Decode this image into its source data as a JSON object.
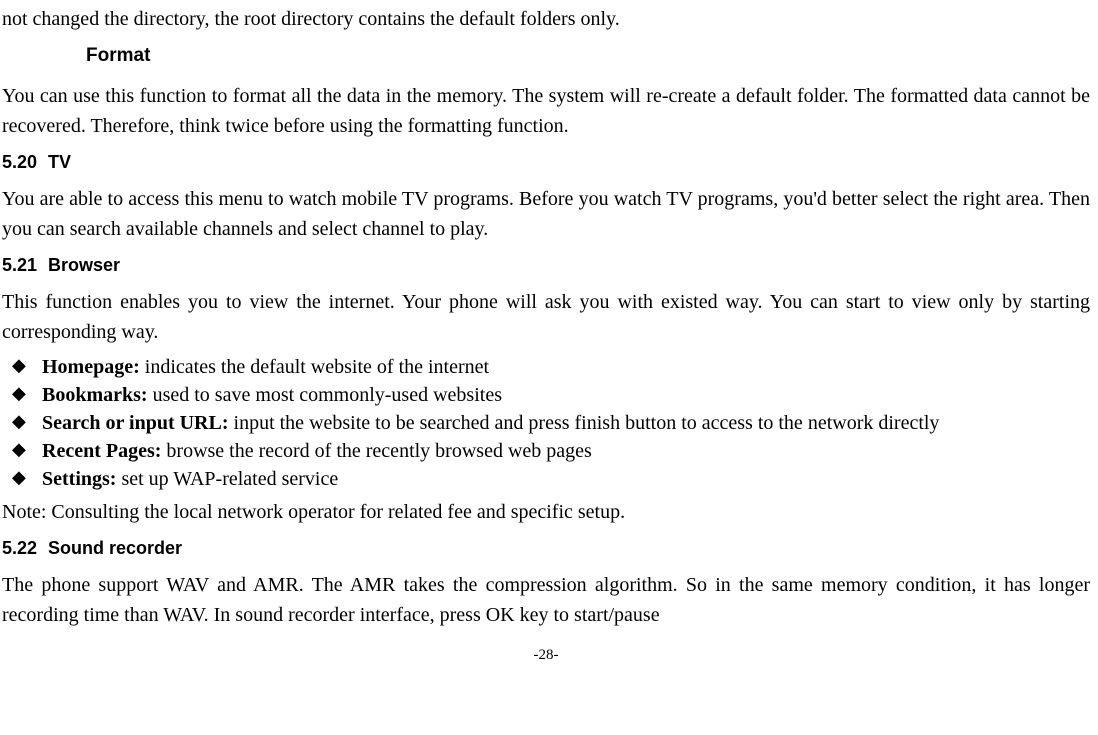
{
  "intro_fragment": "not changed the directory, the root directory contains the default folders only.",
  "format": {
    "heading": "Format",
    "body": "You can use this function to format all the data in the memory. The system will re-create a default folder. The formatted data cannot be recovered. Therefore, think twice before using the formatting function."
  },
  "tv": {
    "number": "5.20",
    "title": "TV",
    "body": "You are able to access this menu to watch mobile TV programs. Before you watch TV programs, you'd better select the right area. Then you can search available channels and select channel to play."
  },
  "browser": {
    "number": "5.21",
    "title": "Browser",
    "intro": "This function enables you to view the internet. Your phone will ask you with existed way. You can start to view only by starting corresponding way.",
    "items": [
      {
        "label": "Homepage:",
        "text": " indicates the default website of the internet"
      },
      {
        "label": "Bookmarks:",
        "text": " used to save most commonly-used websites"
      },
      {
        "label": "Search or input URL:",
        "text": " input the website to be searched and press finish button to access to the network directly"
      },
      {
        "label": "Recent Pages:",
        "text": " browse the record of the recently browsed web pages"
      },
      {
        "label": "Settings:",
        "text": " set up WAP-related service"
      }
    ],
    "note": "Note:    Consulting the local network operator for related fee and specific setup."
  },
  "sound_recorder": {
    "number": "5.22",
    "title": "Sound recorder",
    "body": "The phone support WAV and AMR. The AMR takes the compression algorithm. So in the same memory condition, it has longer recording time than WAV.   In sound recorder interface, press OK key to start/pause"
  },
  "page_number": "-28-"
}
